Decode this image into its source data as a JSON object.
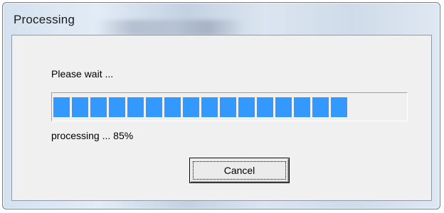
{
  "window": {
    "title": "Processing"
  },
  "dialog": {
    "wait_label": "Please wait ...",
    "status_label": "processing ... 85%",
    "progress_fraction": 0.85,
    "progress_color": "#3399ff",
    "cancel_label": "Cancel"
  }
}
